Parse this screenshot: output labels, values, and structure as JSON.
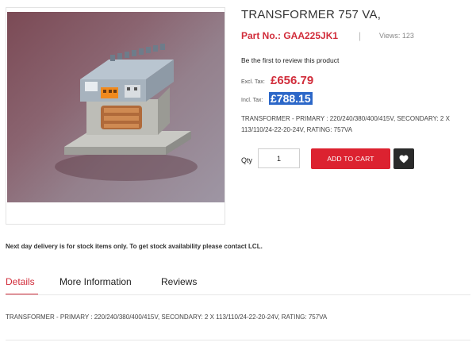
{
  "product": {
    "title": "TRANSFORMER 757 VA,",
    "part_no_label": "Part No.: GAA225JK1",
    "separator": "|",
    "views": "Views: 123",
    "review_prompt": "Be the first to review this product",
    "excl_tax_label": "Excl. Tax:",
    "excl_tax_price": "£656.79",
    "incl_tax_label": "Incl. Tax:",
    "incl_tax_price": "£788.15",
    "short_description": "TRANSFORMER - PRIMARY : 220/240/380/400/415V, SECONDARY: 2 X 113/110/24-22-20-24V, RATING: 757VA",
    "image_alt": "Transformer 757 VA product photo"
  },
  "cart": {
    "qty_label": "Qty",
    "qty_value": "1",
    "add_to_cart_label": "ADD TO CART",
    "wishlist_icon": "heart-icon"
  },
  "notice": "Next day delivery is for stock items only. To get stock availability please contact LCL.",
  "tabs": [
    {
      "label": "Details",
      "active": true
    },
    {
      "label": "More Information",
      "active": false
    },
    {
      "label": "Reviews",
      "active": false
    }
  ],
  "details": {
    "text": "TRANSFORMER - PRIMARY : 220/240/380/400/415V, SECONDARY: 2 X 113/110/24-22-20-24V, RATING: 757VA"
  },
  "colors": {
    "accent": "#d12c3a",
    "button": "#dc2230",
    "wishlist": "#2a2a2a",
    "highlight": "#2c67c8"
  }
}
